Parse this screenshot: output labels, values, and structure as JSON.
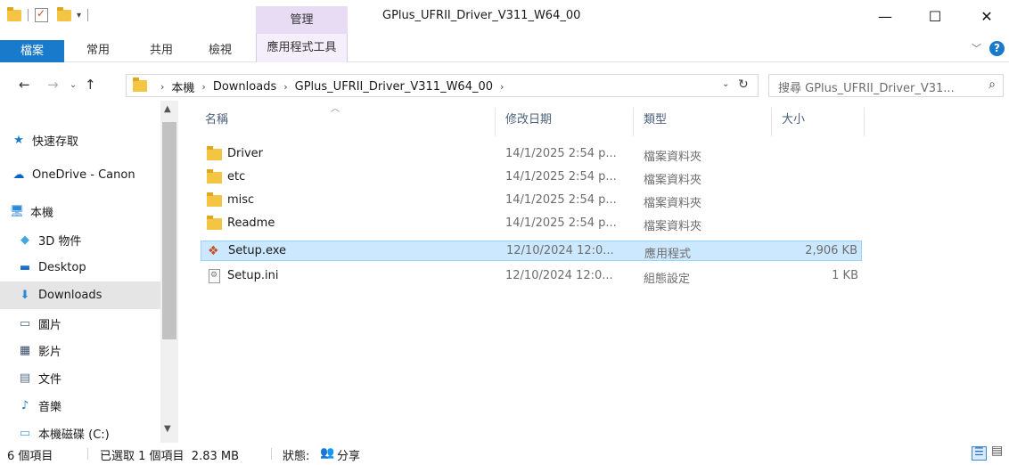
{
  "window": {
    "title": "GPlus_UFRII_Driver_V311_W64_00",
    "manage_tab_header": "管理",
    "minimize": "—",
    "maximize": "☐",
    "close": "✕"
  },
  "ribbon": {
    "tabs": [
      "檔案",
      "常用",
      "共用",
      "檢視",
      "應用程式工具"
    ],
    "help_label": "?",
    "expand_icon": "chevron-down-icon"
  },
  "address": {
    "crumbs": [
      "本機",
      "Downloads",
      "GPlus_UFRII_Driver_V311_W64_00"
    ],
    "search_placeholder": "搜尋 GPlus_UFRII_Driver_V31...",
    "nav_icons": [
      "back-arrow-icon",
      "forward-arrow-icon",
      "recent-locations-icon",
      "up-arrow-icon"
    ]
  },
  "nav_pane": {
    "items": [
      {
        "label": "快速存取",
        "icon": "star-icon",
        "color": "#1979ca"
      },
      {
        "label": "OneDrive - Canon",
        "icon": "cloud-icon",
        "color": "#0a64c8"
      },
      {
        "label": "本機",
        "icon": "computer-icon",
        "color": "#2a8ad8"
      },
      {
        "label": "3D 物件",
        "icon": "cube-icon",
        "color": "#3fa8e0"
      },
      {
        "label": "Desktop",
        "icon": "desktop-icon",
        "color": "#1f6fc4"
      },
      {
        "label": "Downloads",
        "icon": "download-arrow-icon",
        "color": "#2a8ad8"
      },
      {
        "label": "圖片",
        "icon": "pictures-icon",
        "color": "#4a6a8a"
      },
      {
        "label": "影片",
        "icon": "film-icon",
        "color": "#3a4a6a"
      },
      {
        "label": "文件",
        "icon": "document-icon",
        "color": "#5a6f8a"
      },
      {
        "label": "音樂",
        "icon": "music-note-icon",
        "color": "#1979ca"
      },
      {
        "label": "本機磁碟 (C:)",
        "icon": "drive-icon",
        "color": "#5a9ad0"
      }
    ],
    "selected": "Downloads"
  },
  "columns": [
    "名稱",
    "修改日期",
    "類型",
    "大小"
  ],
  "files": [
    {
      "name": "Driver",
      "date": "14/1/2025 2:54 p...",
      "type": "檔案資料夾",
      "size": "",
      "icon": "folder-icon"
    },
    {
      "name": "etc",
      "date": "14/1/2025 2:54 p...",
      "type": "檔案資料夾",
      "size": "",
      "icon": "folder-icon"
    },
    {
      "name": "misc",
      "date": "14/1/2025 2:54 p...",
      "type": "檔案資料夾",
      "size": "",
      "icon": "folder-icon"
    },
    {
      "name": "Readme",
      "date": "14/1/2025 2:54 p...",
      "type": "檔案資料夾",
      "size": "",
      "icon": "folder-icon"
    },
    {
      "name": "Setup.exe",
      "date": "12/10/2024 12:0...",
      "type": "應用程式",
      "size": "2,906 KB",
      "icon": "installer-icon"
    },
    {
      "name": "Setup.ini",
      "date": "12/10/2024 12:0...",
      "type": "組態設定",
      "size": "1 KB",
      "icon": "settings-file-icon"
    }
  ],
  "selected_file": "Setup.exe",
  "status": {
    "item_count": "6 個項目",
    "selection": "已選取 1 個項目  2.83 MB",
    "state_label": "狀態:",
    "state_value": "分享"
  }
}
